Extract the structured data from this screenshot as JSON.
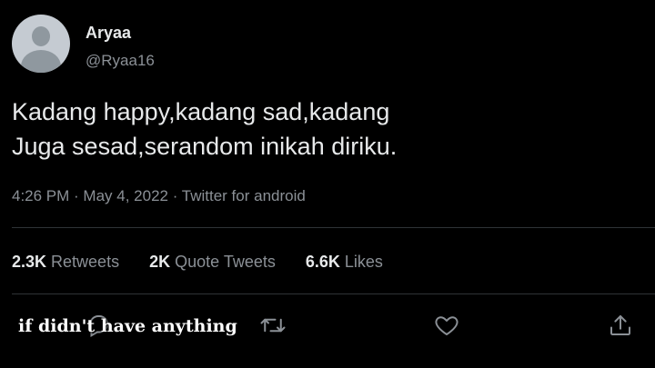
{
  "user": {
    "name": "Aryaa",
    "handle": "@Ryaa16"
  },
  "tweet": {
    "lines": [
      "Kadang happy,kadang sad,kadang",
      "Juga sesad,serandom inikah diriku."
    ],
    "meta": "4:26 PM · May 4, 2022 · Twitter for android"
  },
  "stats": {
    "retweets_count": "2.3K",
    "retweets_label": "Retweets",
    "quotes_count": "2K",
    "quotes_label": "Quote Tweets",
    "likes_count": "6.6K",
    "likes_label": "Likes"
  },
  "actions": [
    "reply-icon",
    "retweet-icon",
    "like-icon",
    "share-icon"
  ],
  "caption": "if didn't have anything",
  "colors": {
    "background": "#000000",
    "text": "#e7e9ea",
    "secondary": "#8b9096",
    "divider": "#2f3336"
  }
}
